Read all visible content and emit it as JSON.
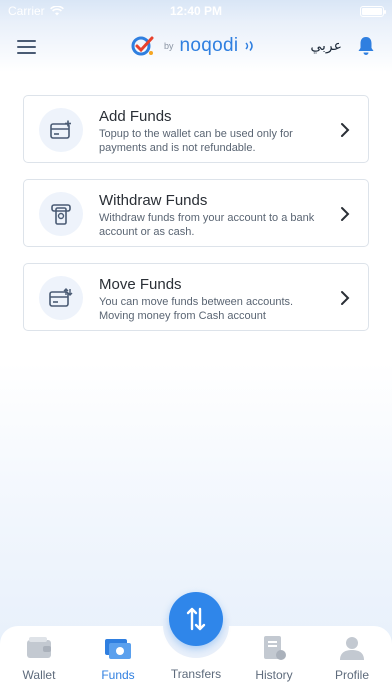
{
  "status_bar": {
    "carrier": "Carrier",
    "time": "12:40 PM"
  },
  "header": {
    "logo_by": "by",
    "logo_name": "noqodi",
    "language_toggle": "عربي",
    "brand_color": "#2f7fe0"
  },
  "cards": [
    {
      "title": "Add Funds",
      "description": "Topup to the wallet can be used only for payments and is not refundable.",
      "icon": "add-funds-icon"
    },
    {
      "title": "Withdraw Funds",
      "description": "Withdraw funds from your account to a bank account or as cash.",
      "icon": "withdraw-funds-icon"
    },
    {
      "title": "Move Funds",
      "description": "You can move funds between accounts. Moving money from Cash account",
      "icon": "move-funds-icon"
    }
  ],
  "tabbar": {
    "tabs": [
      {
        "label": "Wallet",
        "icon": "wallet-icon",
        "active": false
      },
      {
        "label": "Funds",
        "icon": "funds-icon",
        "active": true
      },
      {
        "label": "Transfers",
        "icon": "transfers-icon",
        "active": false
      },
      {
        "label": "History",
        "icon": "history-icon",
        "active": false
      },
      {
        "label": "Profile",
        "icon": "profile-icon",
        "active": false
      }
    ],
    "active_color": "#2f7fe0",
    "inactive_color": "#5e6b7c"
  }
}
